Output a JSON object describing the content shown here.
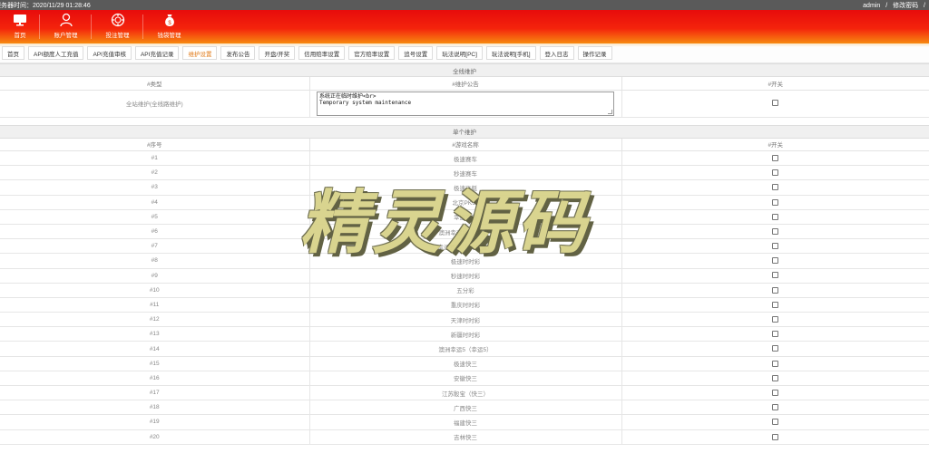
{
  "topbar": {
    "server_time": "服务器时间：2020/11/29 01:28:46",
    "user": "admin",
    "sep1": "/",
    "change_password": "修改密码",
    "sep2": "/"
  },
  "nav": {
    "items": [
      {
        "label": "首页",
        "icon": "monitor-icon"
      },
      {
        "label": "账户管理",
        "icon": "user-icon"
      },
      {
        "label": "投注管理",
        "icon": "chip-icon"
      },
      {
        "label": "钱袋管理",
        "icon": "money-bag-icon"
      }
    ]
  },
  "tabs": [
    "首页",
    "API额度人工充值",
    "API充值审核",
    "API充值记录",
    "维护设置",
    "发布公告",
    "开盘/开奖",
    "信用赔率设置",
    "官方赔率设置",
    "追号设置",
    "玩法说明[PC]",
    "玩法说明[手机]",
    "登入日志",
    "操作记录"
  ],
  "active_tab_index": 4,
  "global": {
    "title": "全线维护",
    "headers": [
      "#类型",
      "#维护公告",
      "#开关"
    ],
    "row_label": "全站维护(全线路维护)",
    "notice_line1": "系统正在临时维护<br>",
    "notice_line2": "Temporary system maintenance",
    "enabled": false
  },
  "single": {
    "title": "单个维护",
    "headers": [
      "#序号",
      "#游戏名称",
      "#开关"
    ],
    "rows": [
      {
        "id": "#1",
        "name": "极速赛车"
      },
      {
        "id": "#2",
        "name": "秒速赛车"
      },
      {
        "id": "#3",
        "name": "极速飞艇"
      },
      {
        "id": "#4",
        "name": "北京PK10"
      },
      {
        "id": "#5",
        "name": "幸运飞艇"
      },
      {
        "id": "#6",
        "name": "澳洲幸运10（赛车）"
      },
      {
        "id": "#7",
        "name": "幸运赛车（PC蛋蛋）"
      },
      {
        "id": "#8",
        "name": "极速时时彩"
      },
      {
        "id": "#9",
        "name": "秒速时时彩"
      },
      {
        "id": "#10",
        "name": "五分彩"
      },
      {
        "id": "#11",
        "name": "重庆时时彩"
      },
      {
        "id": "#12",
        "name": "天津时时彩"
      },
      {
        "id": "#13",
        "name": "新疆时时彩"
      },
      {
        "id": "#14",
        "name": "澳洲幸运5（幸运5）"
      },
      {
        "id": "#15",
        "name": "极速快三"
      },
      {
        "id": "#16",
        "name": "安徽快三"
      },
      {
        "id": "#17",
        "name": "江苏骰宝（快三）"
      },
      {
        "id": "#18",
        "name": "广西快三"
      },
      {
        "id": "#19",
        "name": "福建快三"
      },
      {
        "id": "#20",
        "name": "吉林快三"
      }
    ]
  },
  "watermark": "精灵源码",
  "colors": {
    "header_top": "#e70c0c",
    "header_bottom": "#f78a10",
    "active_tab": "#e07a18"
  }
}
